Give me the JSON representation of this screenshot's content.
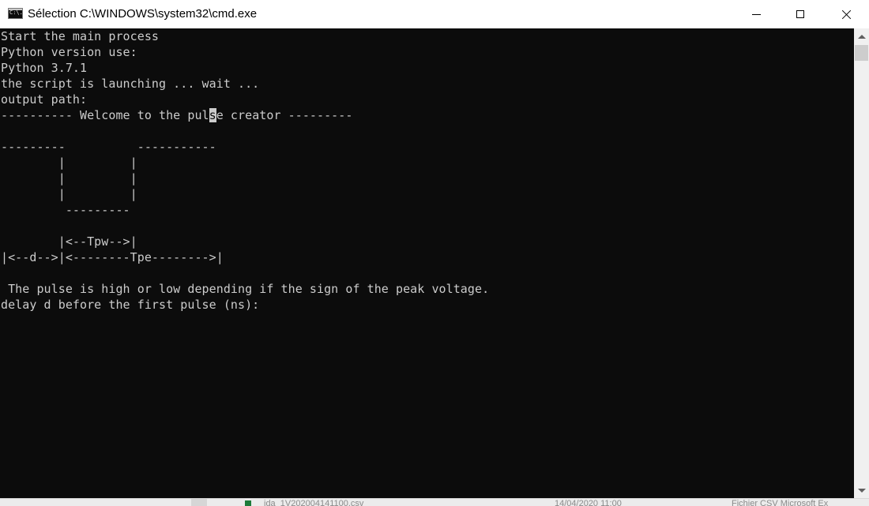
{
  "window": {
    "title": "Sélection C:\\WINDOWS\\system32\\cmd.exe",
    "icon_text": "C:\\."
  },
  "controls": {
    "minimize": "minimize-icon",
    "maximize": "maximize-icon",
    "close": "close-icon"
  },
  "console": {
    "lines": [
      "Start the main process",
      "Python version use:",
      "Python 3.7.1",
      "the script is launching ... wait ...",
      "output path:",
      "",
      "",
      "---------          -----------",
      "        |         |",
      "        |         |",
      "        |         |",
      "         ---------",
      "",
      "        |<--Tpw-->|",
      "|<--d-->|<--------Tpe-------->|",
      "",
      " The pulse is high or low depending if the sign of the peak voltage.",
      "delay d before the first pulse (ns):"
    ],
    "welcome": {
      "before": "---------- Welcome to the pul",
      "cursor": "s",
      "after": "e creator ---------"
    },
    "colors": {
      "background": "#0c0c0c",
      "foreground": "#cccccc"
    }
  },
  "background_window": {
    "filename": "ida_1V202004141100.csv",
    "date": "14/04/2020 11:00",
    "type": "Fichier CSV Microsoft Ex"
  }
}
